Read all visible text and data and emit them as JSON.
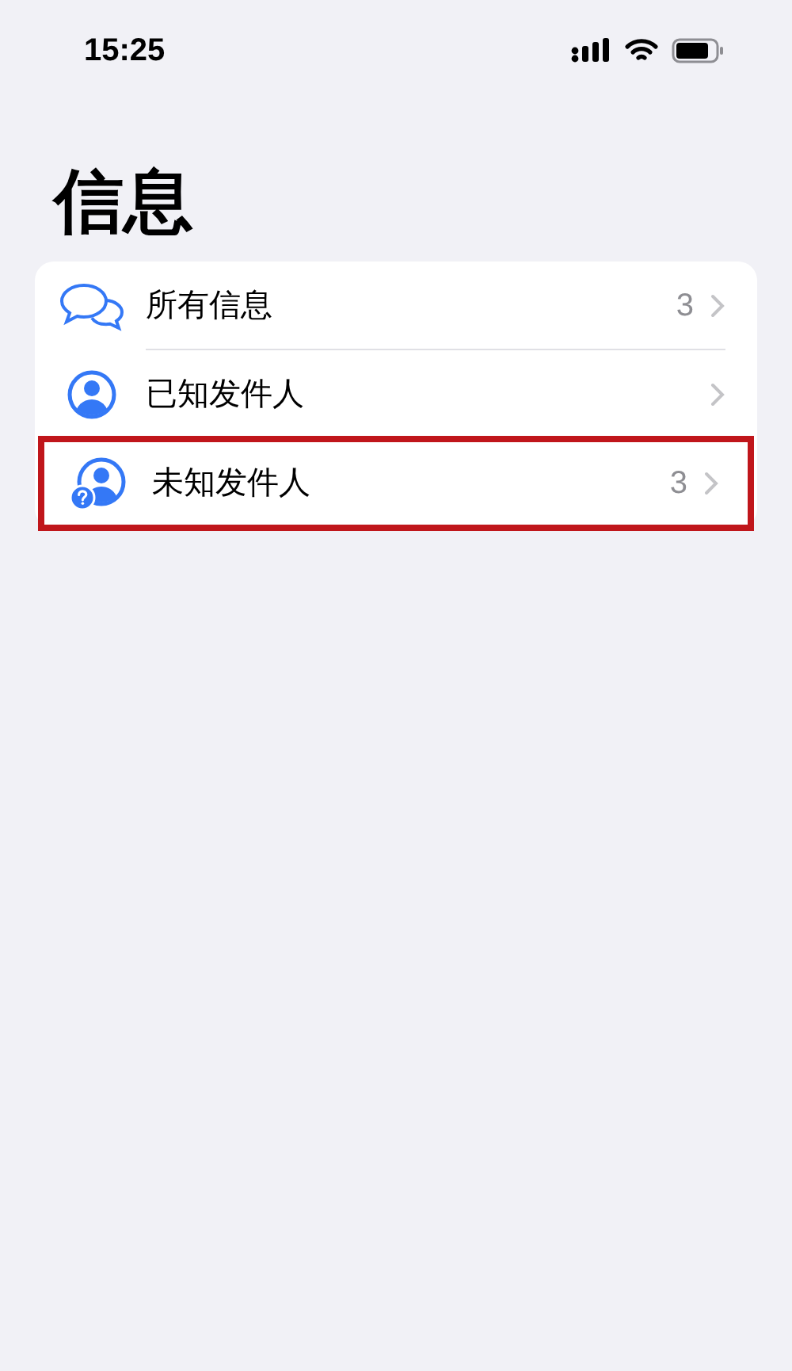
{
  "status_bar": {
    "time": "15:25"
  },
  "title": "信息",
  "items": [
    {
      "kind": "all",
      "label": "所有信息",
      "count": "3",
      "highlighted": false
    },
    {
      "kind": "known",
      "label": "已知发件人",
      "highlighted": false
    },
    {
      "kind": "unknown",
      "label": "未知发件人",
      "count": "3",
      "highlighted": true
    }
  ]
}
